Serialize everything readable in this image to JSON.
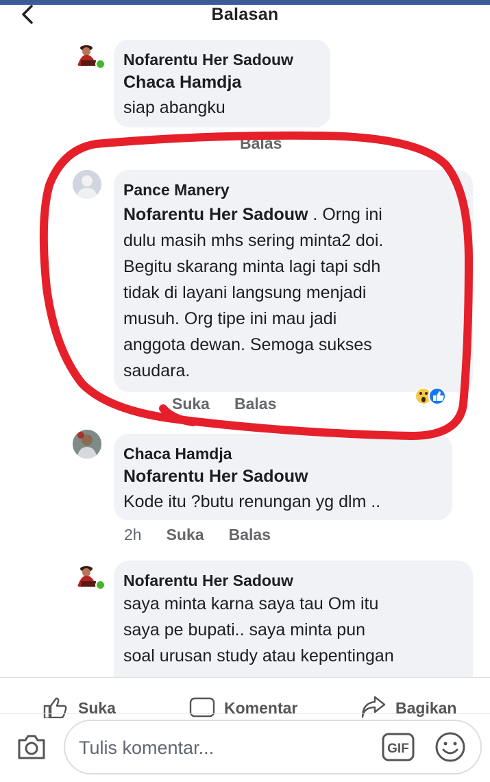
{
  "header": {
    "title": "Balasan"
  },
  "comments": [
    {
      "author": "Nofarentu Her Sadouw",
      "mention": "Chaca Hamdja",
      "lines": [
        "siap abangku"
      ],
      "actions": {
        "reply": "Balas"
      }
    },
    {
      "author": "Pance Manery",
      "mention": "Nofarentu Her Sadouw",
      "mention_suffix": " . Orng ini",
      "lines": [
        "dulu masih mhs sering minta2 doi.",
        "Begitu skarang minta lagi tapi sdh",
        "tidak di layani langsung menjadi",
        "musuh. Org tipe ini  mau jadi",
        "anggota dewan. Semoga sukses",
        "saudara."
      ],
      "actions": {
        "like": "Suka",
        "reply": "Balas"
      },
      "reactions": [
        "wow",
        "like"
      ]
    },
    {
      "author": "Chaca Hamdja",
      "mention": "Nofarentu Her Sadouw",
      "lines": [
        "Kode itu ?butu renungan  yg dlm .."
      ],
      "actions": {
        "time": "2h",
        "like": "Suka",
        "reply": "Balas"
      }
    },
    {
      "author": "Nofarentu Her Sadouw",
      "lines": [
        "saya minta karna saya tau Om itu",
        "saya pe bupati.. saya minta pun",
        "soal urusan study atau kepentingan"
      ]
    }
  ],
  "action_bar": {
    "like": "Suka",
    "comment": "Komentar",
    "share": "Bagikan"
  },
  "composer": {
    "placeholder": "Tulis komentar...",
    "gif_label": "GIF"
  },
  "colors": {
    "top_strip": "#3b5b9a",
    "bubble": "#f0f2f5",
    "annotation": "#e5202a",
    "online": "#42b72a",
    "like": "#1877f2"
  }
}
